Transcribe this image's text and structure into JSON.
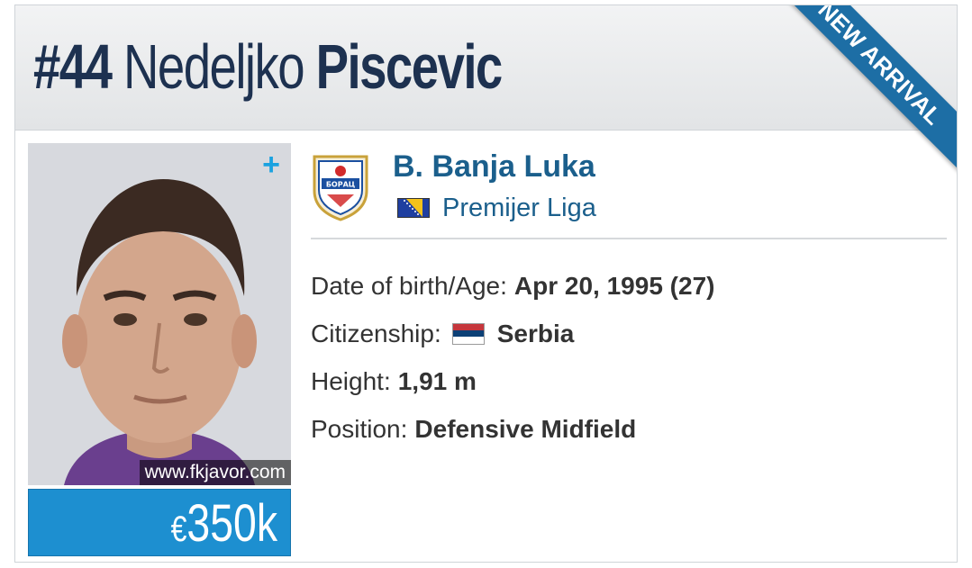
{
  "player": {
    "number": "#44",
    "first_name": "Nedeljko",
    "last_name": "Piscevic"
  },
  "ribbon": {
    "text": "NEW ARRIVAL"
  },
  "photo": {
    "credit": "www.fkjavor.com",
    "add_icon": "plus-icon"
  },
  "market_value": {
    "currency": "€",
    "amount": "350k"
  },
  "club": {
    "name": "B. Banja Luka",
    "crest_text": "БОРАЦ",
    "league": "Premijer Liga",
    "league_flag": "bosnia-herzegovina-flag"
  },
  "details": {
    "dob_label": "Date of birth/Age:",
    "dob_value": "Apr 20, 1995 (27)",
    "citizenship_label": "Citizenship:",
    "citizenship_value": "Serbia",
    "citizenship_flag": "serbia-flag",
    "height_label": "Height:",
    "height_value": "1,91 m",
    "position_label": "Position:",
    "position_value": "Defensive Midfield"
  },
  "colors": {
    "title": "#1d3150",
    "ribbon": "#1d6ea5",
    "link": "#1b5f8c",
    "value_box": "#1d8fd0",
    "plus_icon": "#1aa2e0"
  }
}
